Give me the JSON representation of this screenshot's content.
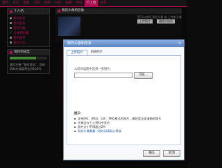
{
  "topnav": {
    "items": [
      "首页",
      "日志",
      "相册",
      "音乐",
      "视频",
      "分享",
      "收藏",
      "秀场",
      "个人档",
      "好友"
    ],
    "active_index": 8
  },
  "sidebar": {
    "profile_title": "个人档",
    "profile_items": [
      {
        "label": "我的资料",
        "kind": "dot"
      },
      {
        "label": "我的联系",
        "kind": "dot"
      },
      {
        "label": "我的兴趣",
        "kind": "dot"
      },
      {
        "label": "头像和形象",
        "kind": "tick"
      },
      {
        "label": "我的教育",
        "kind": "dot"
      },
      {
        "label": "我的工作",
        "kind": "dot"
      }
    ],
    "completion_title": "资料完成度",
    "completion_text": "填写完整 \"我的资料\"，您的资料完成度将达到100%",
    "completion_percent": 70
  },
  "main": {
    "title": "我的头像和形象",
    "note": "您可以使用 现在头像 或 上传新头像",
    "btn_upload": "上传照片",
    "btn_camera": "摄像头拍照"
  },
  "modal": {
    "title": "制作头像和形象",
    "close_glyph": "×",
    "tabs": [
      "上传照片",
      "拍摄照片"
    ],
    "active_tab": 0,
    "upload_label": "从您的电脑中选择一张照片：",
    "file_value": "",
    "browse_label": "浏览...",
    "tips_title": "提示：",
    "tips": [
      "支持JPG、JPEG、GIF、PNG格式的照片，最好是正面清晰的照片",
      "头像会在个人资料中显示",
      "照片大小不得超过2M",
      "制作头像需要一段时间请耐心等候"
    ],
    "ok_label": "确认",
    "cancel_label": "取消"
  }
}
